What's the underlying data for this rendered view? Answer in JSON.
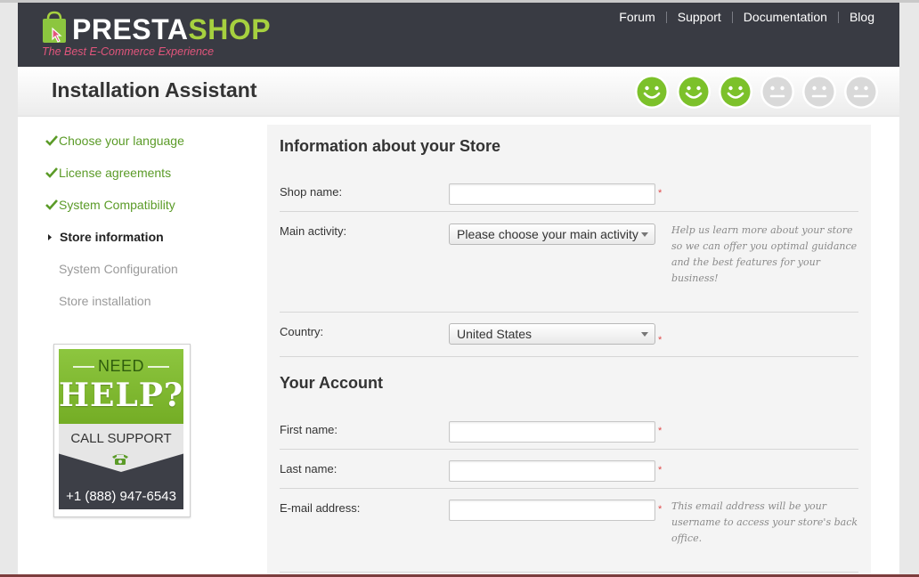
{
  "header": {
    "logo_word_a": "PRESTA",
    "logo_word_b": "SHOP",
    "tagline": "The Best E-Commerce Experience",
    "nav": [
      "Forum",
      "Support",
      "Documentation",
      "Blog"
    ]
  },
  "title": "Installation Assistant",
  "progress": {
    "completed_steps": 3,
    "total_steps": 6
  },
  "steps": [
    {
      "label": "Choose your language",
      "state": "done"
    },
    {
      "label": "License agreements",
      "state": "done"
    },
    {
      "label": "System Compatibility",
      "state": "done"
    },
    {
      "label": "Store information",
      "state": "current"
    },
    {
      "label": "System Configuration",
      "state": "todo"
    },
    {
      "label": "Store installation",
      "state": "todo"
    }
  ],
  "help_box": {
    "need": "NEED",
    "help": "HELP?",
    "call": "CALL SUPPORT",
    "phone": "+1 (888) 947-6543"
  },
  "store_section": {
    "title": "Information about your Store",
    "shop_name_label": "Shop name:",
    "shop_name_value": "",
    "main_activity_label": "Main activity:",
    "main_activity_value": "Please choose your main activity",
    "main_activity_hint": "Help us learn more about your store so we can offer you optimal guidance and the best features for your business!",
    "country_label": "Country:",
    "country_value": "United States"
  },
  "account_section": {
    "title": "Your Account",
    "first_name_label": "First name:",
    "first_name_value": "",
    "last_name_label": "Last name:",
    "last_name_value": "",
    "email_label": "E-mail address:",
    "email_value": "",
    "email_hint": "This email address will be your username to access your store's back office."
  },
  "required_mark": "*",
  "colors": {
    "header_bg": "#393b43",
    "brand_green": "#a6d13f",
    "done_green": "#5b9b28",
    "tagline_pink": "#e2557c",
    "required_red": "#e04a4a"
  }
}
